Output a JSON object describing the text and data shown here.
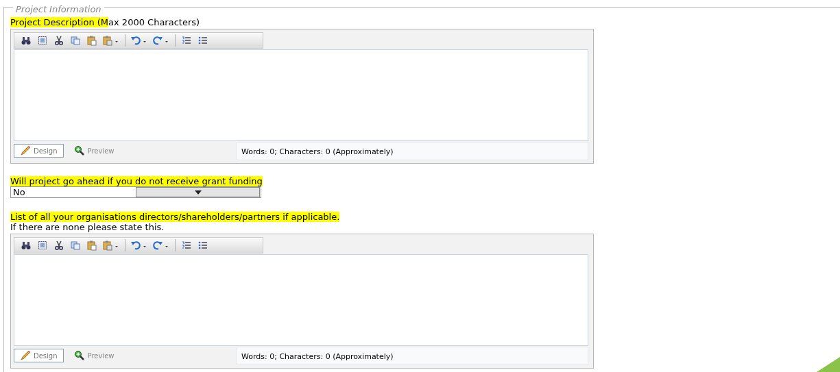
{
  "fieldset": {
    "legend": "Project Information"
  },
  "fields": [
    {
      "kind": "editor",
      "label": {
        "highlighted": "Project Description (M",
        "rest": "ax 2000 Characters)"
      },
      "modes": [
        {
          "label": "Design",
          "selected": true
        },
        {
          "label": "Preview",
          "selected": false
        }
      ],
      "status": "Words: 0; Characters: 0 (Approximately)"
    },
    {
      "kind": "select",
      "label": {
        "highlighted": "Will project go ahead if you do not receive grant funding "
      },
      "value": "No"
    },
    {
      "kind": "editor",
      "label": {
        "highlighted": "List of all your organisations directors/shareholders/partners if applicable. "
      },
      "note": "If there are none please state this.",
      "modes": [
        {
          "label": "Design",
          "selected": true
        },
        {
          "label": "Preview",
          "selected": false
        }
      ],
      "status": "Words: 0; Characters: 0 (Approximately)"
    }
  ]
}
